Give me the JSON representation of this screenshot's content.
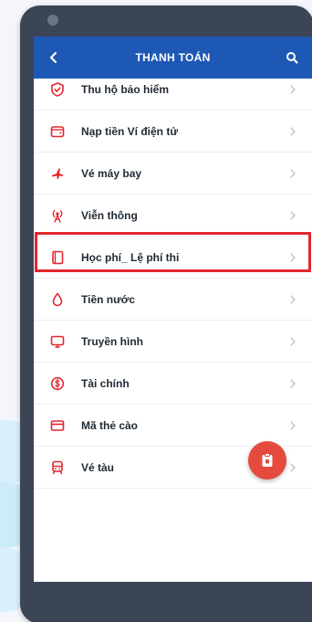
{
  "header": {
    "title": "THANH TOÁN",
    "back_icon": "chevron-left-icon",
    "search_icon": "search-icon"
  },
  "colors": {
    "primary": "#1e58b5",
    "accent_red": "#e44a3e",
    "icon_red": "#e3262f",
    "text": "#1f2933",
    "chevron": "#b8c0cc",
    "highlight_border": "#e3262f"
  },
  "menu": {
    "items": [
      {
        "label": "Thu hộ bảo hiểm",
        "icon": "shield-check-icon"
      },
      {
        "label": "Nạp tiền Ví điện tử",
        "icon": "wallet-icon"
      },
      {
        "label": "Vé máy bay",
        "icon": "airplane-icon"
      },
      {
        "label": "Viễn thông",
        "icon": "antenna-icon"
      },
      {
        "label": "Học phí_ Lệ phí thi",
        "icon": "book-icon",
        "highlighted": true
      },
      {
        "label": "Tiền nước",
        "icon": "water-drop-icon"
      },
      {
        "label": "Truyền hình",
        "icon": "tv-icon"
      },
      {
        "label": "Tài chính",
        "icon": "coin-icon"
      },
      {
        "label": "Mã thẻ cào",
        "icon": "card-icon"
      },
      {
        "label": "Vé tàu",
        "icon": "train-icon"
      }
    ]
  },
  "fab": {
    "icon": "clipboard-icon"
  }
}
